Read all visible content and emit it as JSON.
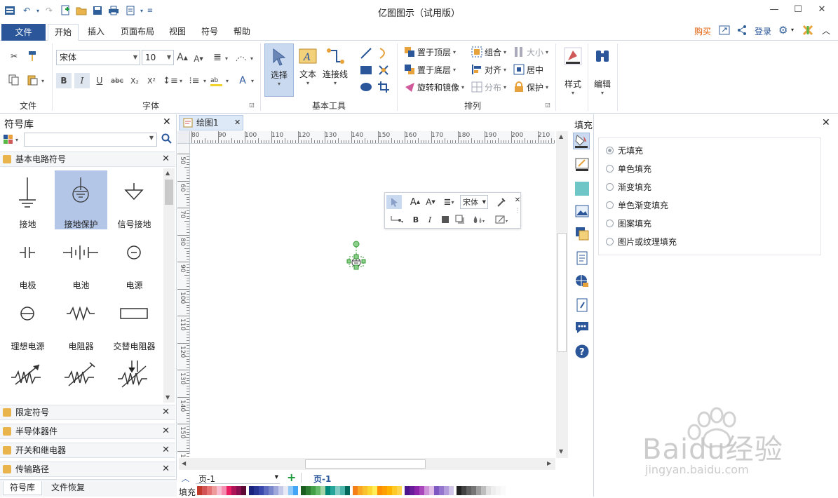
{
  "window": {
    "title": "亿图图示（试用版）",
    "controls": {
      "minimize": "—",
      "maximize": "☐",
      "close": "✕"
    }
  },
  "menu": {
    "file": "文件",
    "tabs": [
      "开始",
      "插入",
      "页面布局",
      "视图",
      "符号",
      "帮助"
    ],
    "right": {
      "buy": "购买",
      "login": "登录"
    }
  },
  "ribbon": {
    "groups": {
      "file": "文件",
      "font": "字体",
      "basic_tools": "基本工具",
      "arrange": "排列"
    },
    "font_name": "宋体",
    "font_size": "10",
    "big_buttons": {
      "select": "选择",
      "text": "文本",
      "connector": "连接线",
      "style": "样式",
      "edit": "编辑"
    },
    "arrange": {
      "bring_front": "置于顶层",
      "send_back": "置于底层",
      "rotate_mirror": "旋转和镜像",
      "group": "组合",
      "align": "对齐",
      "distribute": "分布",
      "size": "大小",
      "center": "居中",
      "protect": "保护"
    },
    "format_buttons": {
      "bold": "B",
      "italic": "I",
      "underline": "U",
      "strike": "abc",
      "sub": "X₂",
      "sup": "X²"
    }
  },
  "left_panel": {
    "title": "符号库",
    "active_category": "基本电路符号",
    "symbols": [
      {
        "label": "接地",
        "icon": "ground-icon"
      },
      {
        "label": "接地保护",
        "icon": "protective-ground-icon",
        "selected": true
      },
      {
        "label": "信号接地",
        "icon": "signal-ground-icon"
      },
      {
        "label": "电极",
        "icon": "electrode-icon"
      },
      {
        "label": "电池",
        "icon": "battery-icon"
      },
      {
        "label": "电源",
        "icon": "power-source-icon"
      },
      {
        "label": "理想电源",
        "icon": "ideal-source-icon"
      },
      {
        "label": "电阻器",
        "icon": "resistor-icon"
      },
      {
        "label": "交替电阻器",
        "icon": "alt-resistor-icon"
      },
      {
        "label": "",
        "icon": "variable-resistor-icon"
      },
      {
        "label": "",
        "icon": "adjustable-resistor-icon"
      },
      {
        "label": "",
        "icon": "preset-resistor-icon"
      }
    ],
    "collapsed_categories": [
      "限定符号",
      "半导体器件",
      "开关和继电器",
      "传输路径"
    ],
    "bottom_tabs": [
      "符号库",
      "文件恢复"
    ]
  },
  "document": {
    "tab_title": "绘图1",
    "hruler_ticks": [
      "80",
      "90",
      "100",
      "110",
      "120",
      "130",
      "140",
      "150",
      "160",
      "170",
      "180",
      "190",
      "200",
      "210"
    ],
    "vruler_ticks": [
      "50",
      "60",
      "70",
      "80",
      "90",
      "100",
      "110",
      "120",
      "130",
      "140",
      "150",
      "160"
    ],
    "mini_toolbar": {
      "font": "宋体"
    },
    "page_selector": "页-1",
    "page_tab": "页-1",
    "fill_label": "填充"
  },
  "fill_panel": {
    "title": "填充",
    "options": [
      {
        "label": "无填充",
        "selected": true
      },
      {
        "label": "单色填充",
        "selected": false
      },
      {
        "label": "渐变填充",
        "selected": false
      },
      {
        "label": "单色渐变填充",
        "selected": false
      },
      {
        "label": "图案填充",
        "selected": false
      },
      {
        "label": "图片或纹理填充",
        "selected": false
      }
    ]
  },
  "watermark": {
    "logo": "Baidu经验",
    "url": "jingyan.baidu.com"
  },
  "colors": {
    "accent": "#2b579a",
    "buy": "#e05a00",
    "selected_symbol": "#b4c6e7",
    "select_btn": "#c9daf0"
  }
}
